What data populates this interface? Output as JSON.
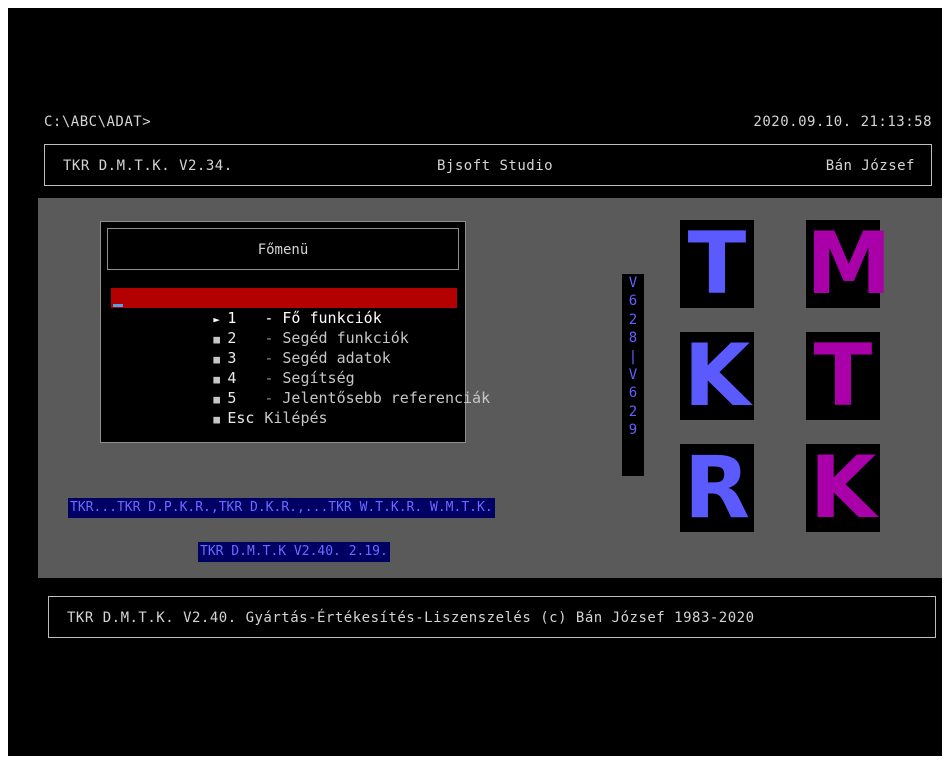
{
  "prompt": {
    "path": "C:\\ABC\\ADAT>",
    "datetime": "2020.09.10. 21:13:58"
  },
  "header": {
    "left": "TKR D.M.T.K. V2.34.",
    "center": "Bjsoft Studio",
    "right": "Bán József"
  },
  "menu": {
    "title": "Főmenü",
    "items": [
      {
        "bullet": "►",
        "key": "1",
        "sep": " - ",
        "label": "Fő funkciók",
        "selected": true
      },
      {
        "bullet": "■",
        "key": "2",
        "sep": " - ",
        "label": "Segéd funkciók",
        "selected": false
      },
      {
        "bullet": "■",
        "key": "3",
        "sep": " - ",
        "label": "Segéd adatok",
        "selected": false
      },
      {
        "bullet": "■",
        "key": "4",
        "sep": " - ",
        "label": "Segítség",
        "selected": false
      },
      {
        "bullet": "■",
        "key": "5",
        "sep": " - ",
        "label": "Jelentősebb referenciák",
        "selected": false
      },
      {
        "bullet": "■",
        "key": "Esc",
        "sep": " ",
        "label": "Kilépés",
        "selected": false
      }
    ]
  },
  "version_column": [
    "V",
    "6",
    "2",
    "8",
    "|",
    "V",
    "6",
    "2",
    "9"
  ],
  "logo_letters": {
    "left": [
      "T",
      "K",
      "R"
    ],
    "right": [
      "M",
      "T",
      "K"
    ],
    "colors": {
      "left": "#5a5aff",
      "right": "#aa00aa"
    }
  },
  "bottom_strip_1": "TKR...TKR D.P.K.R.,TKR D.K.R.,...TKR W.T.K.R. W.M.T.K.",
  "bottom_strip_2": "TKR D.M.T.K V2.40. 2.19.",
  "footer": "TKR D.M.T.K. V2.40. Gyártás-Értékesítés-Liszenszelés (c) Bán József 1983-2020",
  "colors": {
    "selection": "#b30000",
    "desktop": "#5a5a5a",
    "strip_bg": "#000064",
    "strip_text": "#6b6bff"
  }
}
